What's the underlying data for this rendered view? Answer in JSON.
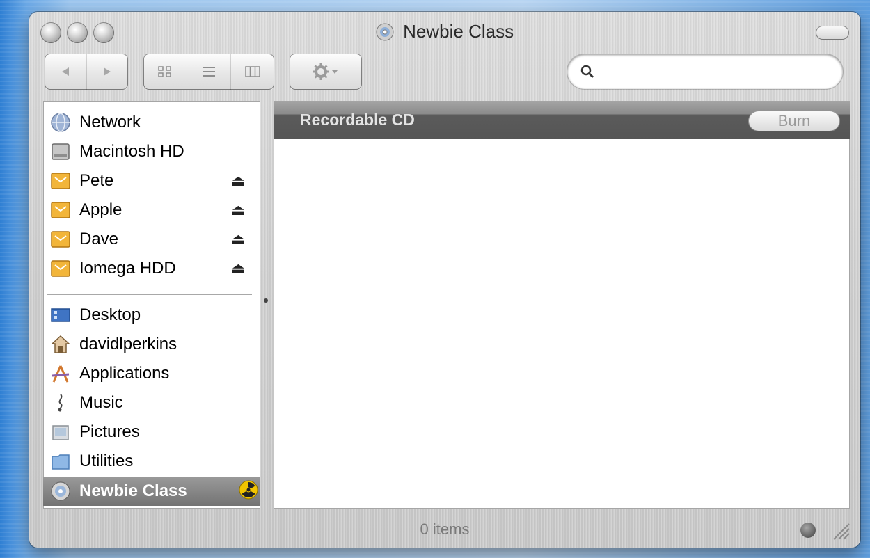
{
  "window": {
    "title": "Newbie Class",
    "title_icon": "cd-icon"
  },
  "toolbar": {
    "back_icon": "back-arrow-icon",
    "forward_icon": "forward-arrow-icon",
    "view_icons": [
      "icon-view-icon",
      "list-view-icon",
      "column-view-icon"
    ],
    "action_icon": "gear-icon",
    "search": {
      "value": "",
      "placeholder": "",
      "icon": "search-icon"
    }
  },
  "sidebar": {
    "devices": [
      {
        "label": "Network",
        "icon": "network-globe-icon",
        "eject": false
      },
      {
        "label": "Macintosh HD",
        "icon": "hard-drive-icon",
        "eject": false
      },
      {
        "label": "Pete",
        "icon": "shared-folder-icon",
        "eject": true
      },
      {
        "label": "Apple",
        "icon": "shared-folder-icon",
        "eject": true
      },
      {
        "label": "Dave",
        "icon": "shared-folder-icon",
        "eject": true
      },
      {
        "label": "Iomega HDD",
        "icon": "shared-folder-icon",
        "eject": true
      }
    ],
    "places": [
      {
        "label": "Desktop",
        "icon": "desktop-icon"
      },
      {
        "label": "davidlperkins",
        "icon": "home-icon"
      },
      {
        "label": "Applications",
        "icon": "applications-icon"
      },
      {
        "label": "Music",
        "icon": "music-icon"
      },
      {
        "label": "Pictures",
        "icon": "pictures-icon"
      },
      {
        "label": "Utilities",
        "icon": "folder-icon"
      },
      {
        "label": "Newbie Class",
        "icon": "cd-icon",
        "selected": true,
        "burn_icon": "radiation-icon"
      }
    ],
    "eject_glyph": "⏏"
  },
  "content": {
    "header_title": "Recordable CD",
    "burn_label": "Burn"
  },
  "status": {
    "items_text": "0 items"
  },
  "colors": {
    "selected_row": "#7a7a7a",
    "burn_bar": "#5a5a5a",
    "radiation": "#f2c400"
  }
}
